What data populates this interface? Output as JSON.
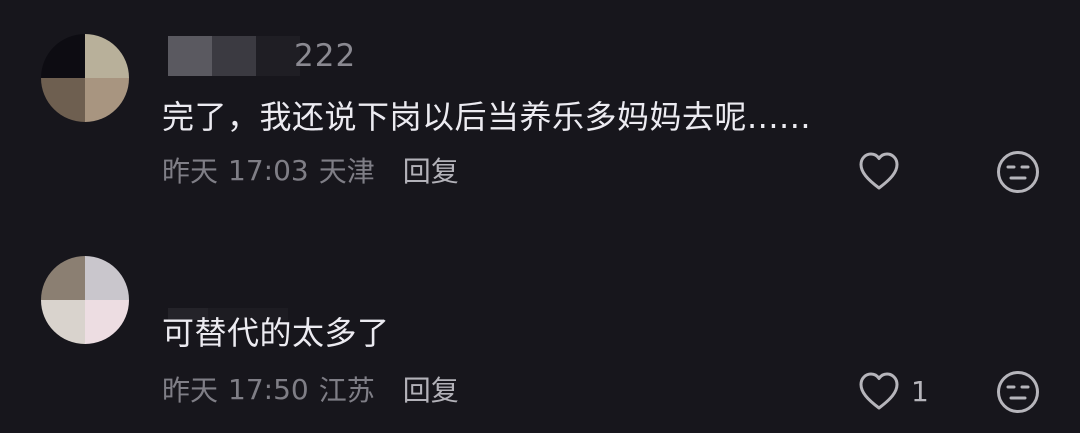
{
  "comments": [
    {
      "username": "222",
      "text": "完了，我还说下岗以后当养乐多妈妈去呢......",
      "date": "昨天",
      "time": "17:03",
      "location": "天津",
      "reply_label": "回复",
      "like_count": "",
      "like_icon": "heart-outline-icon",
      "dislike_icon": "neutral-face-icon"
    },
    {
      "username": "",
      "text": "可替代的太多了",
      "date": "昨天",
      "time": "17:50",
      "location": "江苏",
      "reply_label": "回复",
      "like_count": "1",
      "like_icon": "heart-outline-icon",
      "dislike_icon": "neutral-face-icon"
    }
  ],
  "colors": {
    "background": "#17161c",
    "text_primary": "#ecebf1",
    "text_secondary": "#7f7e86",
    "icon": "#b6b5bb"
  }
}
